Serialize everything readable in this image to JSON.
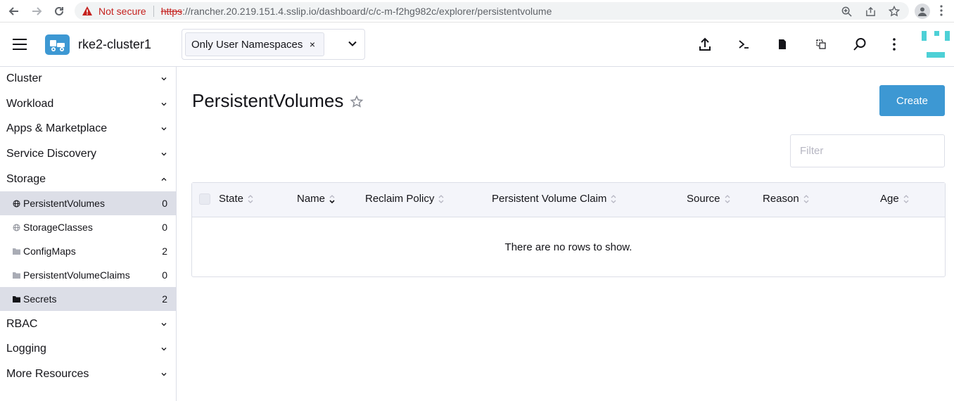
{
  "browser": {
    "security_label": "Not secure",
    "url_scheme": "https",
    "url_rest": "://rancher.20.219.151.4.sslip.io/dashboard/c/c-m-f2hg982c/explorer/persistentvolume"
  },
  "header": {
    "cluster_name": "rke2-cluster1",
    "namespace_filter": "Only User Namespaces",
    "namespace_remove": "×"
  },
  "sidebar": {
    "groups_top": [
      {
        "label": "Cluster"
      },
      {
        "label": "Workload"
      },
      {
        "label": "Apps & Marketplace"
      },
      {
        "label": "Service Discovery"
      },
      {
        "label": "Storage"
      }
    ],
    "storage_items": [
      {
        "label": "PersistentVolumes",
        "count": "0"
      },
      {
        "label": "StorageClasses",
        "count": "0"
      },
      {
        "label": "ConfigMaps",
        "count": "2"
      },
      {
        "label": "PersistentVolumeClaims",
        "count": "0"
      },
      {
        "label": "Secrets",
        "count": "2"
      }
    ],
    "groups_bottom": [
      {
        "label": "RBAC"
      },
      {
        "label": "Logging"
      },
      {
        "label": "More Resources"
      }
    ]
  },
  "main": {
    "title": "PersistentVolumes",
    "create_label": "Create",
    "filter_placeholder": "Filter",
    "columns": [
      "State",
      "Name",
      "Reclaim Policy",
      "Persistent Volume Claim",
      "Source",
      "Reason",
      "Age"
    ],
    "empty_message": "There are no rows to show."
  },
  "colors": {
    "accent": "#3d98d3",
    "active_row": "#dcdee7",
    "warning": "#c5221f"
  }
}
